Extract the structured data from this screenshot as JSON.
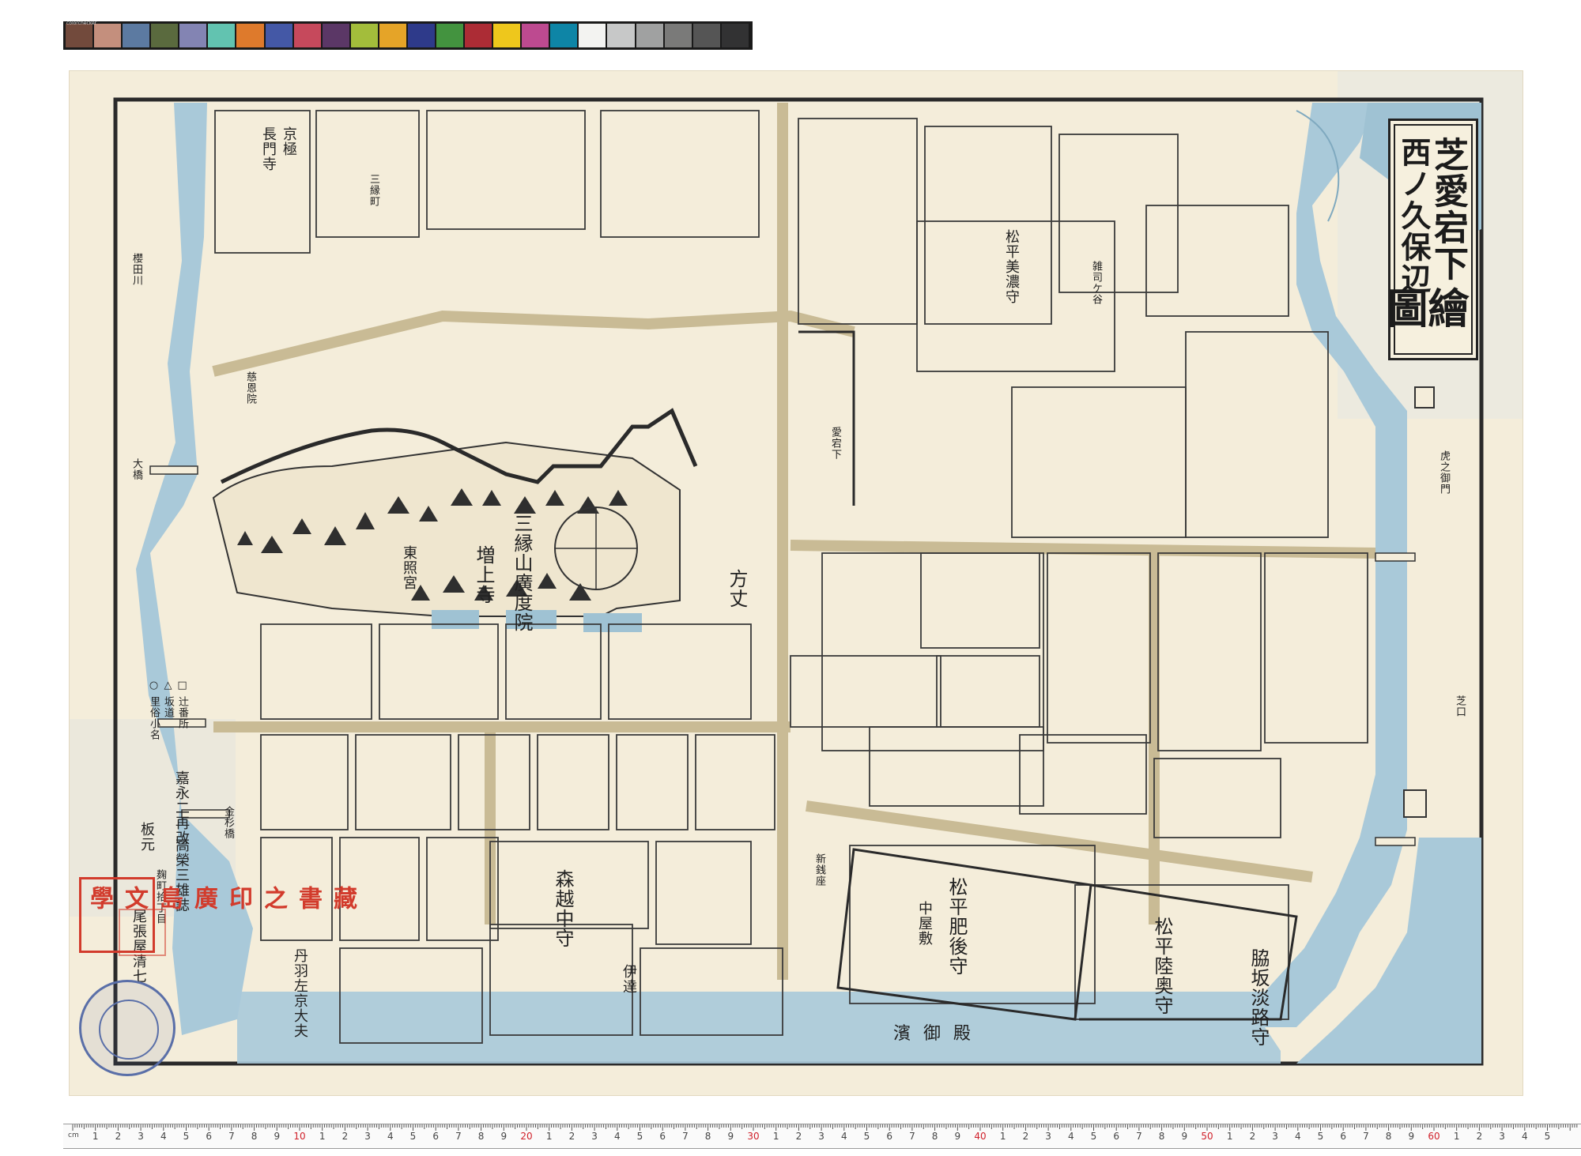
{
  "map": {
    "title": [
      "芝愛宕下",
      "西ノ久保辺",
      "繪圖"
    ]
  },
  "color_checker": {
    "label": "colorchecker",
    "swatches": [
      "#724a3c",
      "#c48f7d",
      "#5c7aa1",
      "#5a6a3e",
      "#8384b3",
      "#62c3b0",
      "#de7a2c",
      "#4458a6",
      "#c6495c",
      "#5b3766",
      "#a3bd3b",
      "#e5a428",
      "#2e3a8a",
      "#43933f",
      "#ac2c35",
      "#eec71c",
      "#bd4a90",
      "#0e85a6",
      "#f3f3f1",
      "#c7c8c8",
      "#a0a1a1",
      "#7a7a79",
      "#555555",
      "#323233"
    ]
  },
  "places": {
    "zojoji": "三縁山廣度院",
    "zojoji2": "増上寺",
    "toshogu": "東照宮",
    "hojo": "方丈",
    "hama_goten": "濱御殿",
    "matsudaira_higo": "松平肥後守",
    "nakayashiki": "中屋敷",
    "matsudaira_mutsu": "松平陸奥守",
    "wakisaka": "脇坂淡路守",
    "mori": "森越中守",
    "matsudaira_minoji": "松平美濃守",
    "kyogoku": "京極",
    "chomonji": "長門寺",
    "date": "伊達",
    "shiba_gomon": "虎之御門",
    "tanba": "丹羽左京大夫",
    "shibaguchi": "芝口",
    "kinsugibashi": "金杉橋",
    "shinsenza": "新銭座",
    "atagoshita": "愛宕下",
    "sakuradagawa": "櫻田川",
    "ohashi": "大橋",
    "sanencho": "三縁町",
    "zasshojoji": "雑司ケ谷",
    "jikyo": "慈恩院"
  },
  "legend": {
    "items": [
      "□ 辻番所",
      "△ 坂道",
      "○ 里俗小名"
    ]
  },
  "colophon": {
    "date": "嘉永二再改",
    "author": "高榮三雄誌",
    "hanmoto_label": "板元",
    "publisher": "麹町拾丁目",
    "publisher2": "尾張屋清七"
  },
  "seals": {
    "red": [
      "廣島文學",
      "藏書之印"
    ]
  },
  "ruler": {
    "unit_label": "cm",
    "major_labels": [
      "10",
      "20",
      "30",
      "40",
      "50",
      "60"
    ],
    "minor_labels": [
      "1",
      "2",
      "3",
      "4",
      "5",
      "6",
      "7",
      "8",
      "9"
    ]
  }
}
